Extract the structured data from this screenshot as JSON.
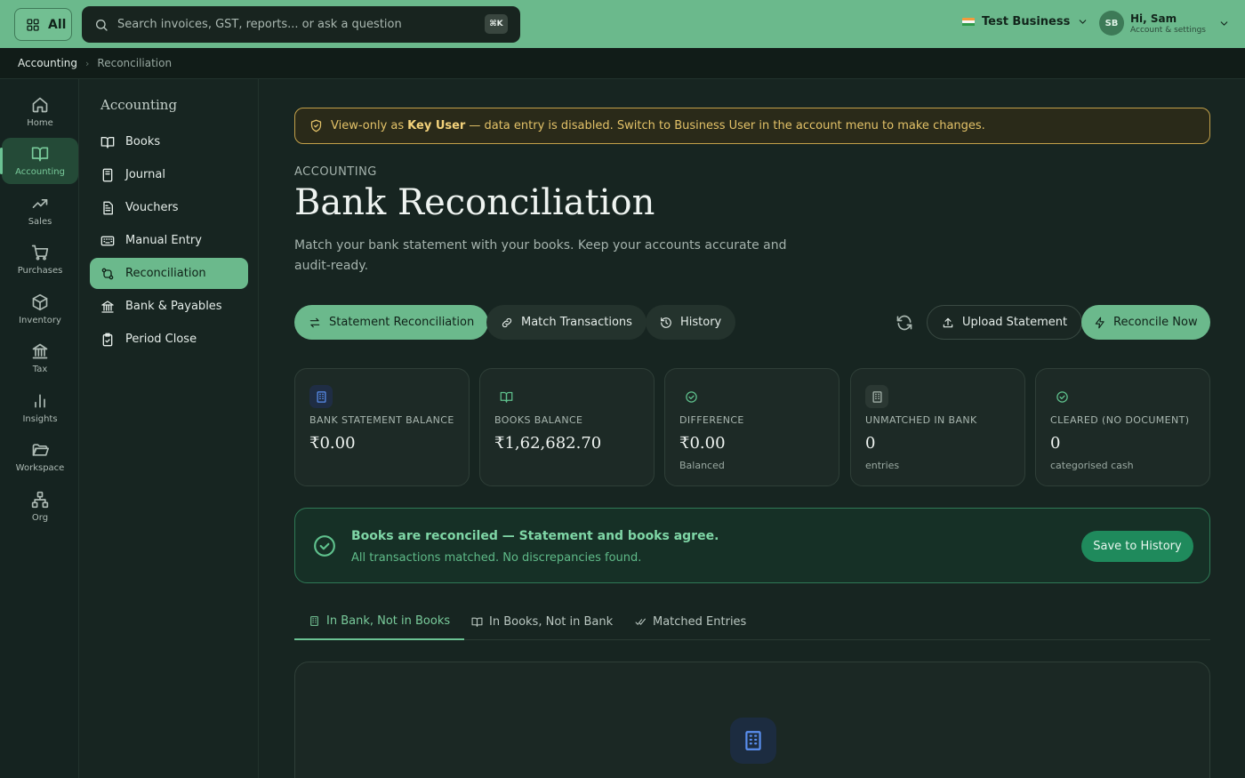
{
  "topbar": {
    "all_label": "All",
    "search_placeholder": "Search invoices, GST, reports... or ask a question",
    "shortcut": "⌘K",
    "business_name": "Test Business",
    "user": {
      "initials": "SB",
      "greeting": "Hi, Sam",
      "subtitle": "Account & settings"
    }
  },
  "breadcrumb": {
    "root": "Accounting",
    "current": "Reconciliation"
  },
  "rail": [
    {
      "label": "Home",
      "icon": "home-icon",
      "active": false
    },
    {
      "label": "Accounting",
      "icon": "book-open-icon",
      "active": true
    },
    {
      "label": "Sales",
      "icon": "trending-up-icon",
      "active": false
    },
    {
      "label": "Purchases",
      "icon": "cart-icon",
      "active": false
    },
    {
      "label": "Inventory",
      "icon": "box-icon",
      "active": false
    },
    {
      "label": "Tax",
      "icon": "bank-icon",
      "active": false
    },
    {
      "label": "Insights",
      "icon": "bar-chart-icon",
      "active": false
    },
    {
      "label": "Workspace",
      "icon": "folder-open-icon",
      "active": false
    },
    {
      "label": "Org",
      "icon": "org-chart-icon",
      "active": false
    }
  ],
  "section_nav": {
    "title": "Accounting",
    "items": [
      {
        "label": "Books",
        "icon": "book-open-icon"
      },
      {
        "label": "Journal",
        "icon": "notebook-icon"
      },
      {
        "label": "Vouchers",
        "icon": "document-icon"
      },
      {
        "label": "Manual Entry",
        "icon": "keyboard-icon"
      },
      {
        "label": "Reconciliation",
        "icon": "git-compare-icon",
        "active": true
      },
      {
        "label": "Bank & Payables",
        "icon": "bank-icon"
      },
      {
        "label": "Period Close",
        "icon": "clipboard-icon"
      }
    ]
  },
  "notice": {
    "prefix": "View-only as",
    "role": "Key User",
    "suffix": "— data entry is disabled. Switch to Business User in the account menu to make changes."
  },
  "page": {
    "eyebrow": "ACCOUNTING",
    "title": "Bank Reconciliation",
    "description": "Match your bank statement with your books. Keep your accounts accurate and audit-ready."
  },
  "actions": {
    "statement_reconciliation": "Statement Reconciliation",
    "match_transactions": "Match Transactions",
    "history": "History",
    "upload_statement": "Upload Statement",
    "reconcile_now": "Reconcile Now"
  },
  "cards": [
    {
      "label": "BANK STATEMENT BALANCE",
      "value": "₹0.00",
      "sub": "",
      "icon": "building-icon",
      "accent": "#5a8ff0"
    },
    {
      "label": "BOOKS BALANCE",
      "value": "₹1,62,682.70",
      "sub": "",
      "icon": "book-open-icon",
      "accent": "#5fc18d"
    },
    {
      "label": "DIFFERENCE",
      "value": "₹0.00",
      "sub": "Balanced",
      "icon": "check-circle-icon",
      "accent": "#5fc18d"
    },
    {
      "label": "UNMATCHED IN BANK",
      "value": "0",
      "sub": "entries",
      "icon": "building-icon",
      "accent": "#a9b7b0"
    },
    {
      "label": "CLEARED (NO DOCUMENT)",
      "value": "0",
      "sub": "categorised cash",
      "icon": "check-circle-icon",
      "accent": "#5fc18d"
    }
  ],
  "status": {
    "title": "Books are reconciled — Statement and books agree.",
    "subtitle": "All transactions matched. No discrepancies found.",
    "save_label": "Save to History"
  },
  "subtabs": [
    {
      "label": "In Bank, Not in Books",
      "icon": "building-icon",
      "active": true
    },
    {
      "label": "In Books, Not in Bank",
      "icon": "book-open-icon",
      "active": false
    },
    {
      "label": "Matched Entries",
      "icon": "double-check-icon",
      "active": false
    }
  ],
  "colors": {
    "accent": "#6bb98c",
    "success": "#5fc18d",
    "warning": "#e3c268",
    "info": "#5a8ff0"
  }
}
